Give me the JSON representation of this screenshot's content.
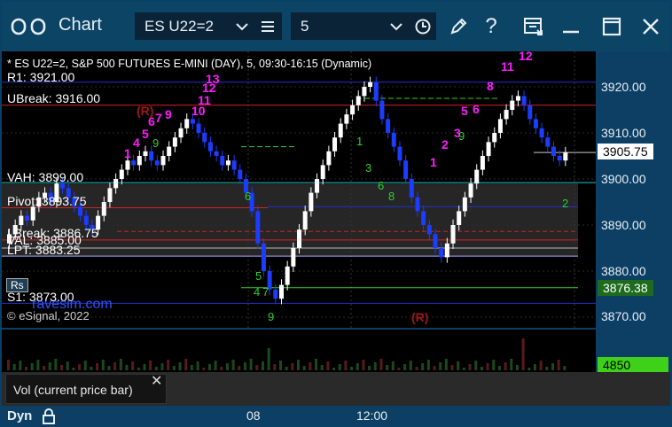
{
  "window": {
    "title": "Chart",
    "title_icon": "grid-icon",
    "symbol": "ES U22=2",
    "interval": "5",
    "buttons": [
      "menu-icon",
      "clock-icon",
      "help-icon",
      "layout-icon",
      "minimize-icon",
      "maximize-icon",
      "close-icon"
    ],
    "help_label": "?"
  },
  "header_line": "* ES U22=2, S&P 500 FUTURES E-MINI (DAY), 5, 09:30-16:15 (Dynamic)",
  "levels": {
    "r1": "R1: 3921.00",
    "ubreak": "UBreak: 3916.00",
    "vah": "VAH: 3899.00",
    "pivot": "Pivot: 3893.75",
    "lbreak": "LBreak: 3886.75",
    "val": "VAL: 3885.00",
    "lpt": "LPT: 3883.25",
    "s1": "S1: 3873.00"
  },
  "copyright": "© eSignal, 2022",
  "watermark": "ravesim.com",
  "marker_r": "(R)",
  "marker_rs": "Rs",
  "price_axis": {
    "ticks": [
      "3920.00",
      "3910.00",
      "3900.00",
      "3890.00",
      "3880.00",
      "3870.00"
    ],
    "current_price": "3905.75",
    "green_level": "3876.38",
    "volume_value": "4850"
  },
  "colors": {
    "accent": "#0c4466",
    "up_candle": "#ffffff",
    "down_candle": "#1c3cff",
    "magenta": "#ff1cff",
    "green": "#2fd02f",
    "red_line": "#d42020",
    "blue_line": "#2030d0"
  },
  "lower_panel": {
    "label": "Vol (current price bar)",
    "close": "✕"
  },
  "bottom": {
    "mode": "Dyn",
    "lock_icon": "lock-icon",
    "time_labels": [
      "08",
      "12:00"
    ]
  }
}
